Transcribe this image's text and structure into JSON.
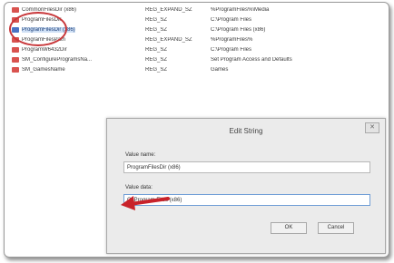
{
  "registry_rows": [
    {
      "icon": "ab",
      "name": "CommonFilesDir (x86)",
      "type": "REG_EXPAND_SZ",
      "data": "%ProgramFiles%\\Media",
      "selected": false
    },
    {
      "icon": "ab",
      "name": "ProgramFilesDir",
      "type": "REG_SZ",
      "data": "C:\\Program Files",
      "selected": false
    },
    {
      "icon": "bin",
      "name": "ProgramFilesDir (x86)",
      "type": "REG_SZ",
      "data": "C:\\Program Files (x86)",
      "selected": true
    },
    {
      "icon": "ab",
      "name": "ProgramFilesPath",
      "type": "REG_EXPAND_SZ",
      "data": "%ProgramFiles%",
      "selected": false
    },
    {
      "icon": "ab",
      "name": "ProgramW6432Dir",
      "type": "REG_SZ",
      "data": "C:\\Program Files",
      "selected": false
    },
    {
      "icon": "ab",
      "name": "SM_ConfigureProgramsNa...",
      "type": "REG_SZ",
      "data": "Set Program Access and Defaults",
      "selected": false
    },
    {
      "icon": "ab",
      "name": "SM_GamesName",
      "type": "REG_SZ",
      "data": "Games",
      "selected": false
    }
  ],
  "dialog": {
    "title": "Edit String",
    "close_label": "✕",
    "value_name_label": "Value name:",
    "value_name": "ProgramFilesDir (x86)",
    "value_data_label": "Value data:",
    "value_data": "C:\\Program Files (x86)",
    "ok_label": "OK",
    "cancel_label": "Cancel"
  },
  "colors": {
    "annotation": "#c8373a",
    "arrow": "#c8222a"
  }
}
